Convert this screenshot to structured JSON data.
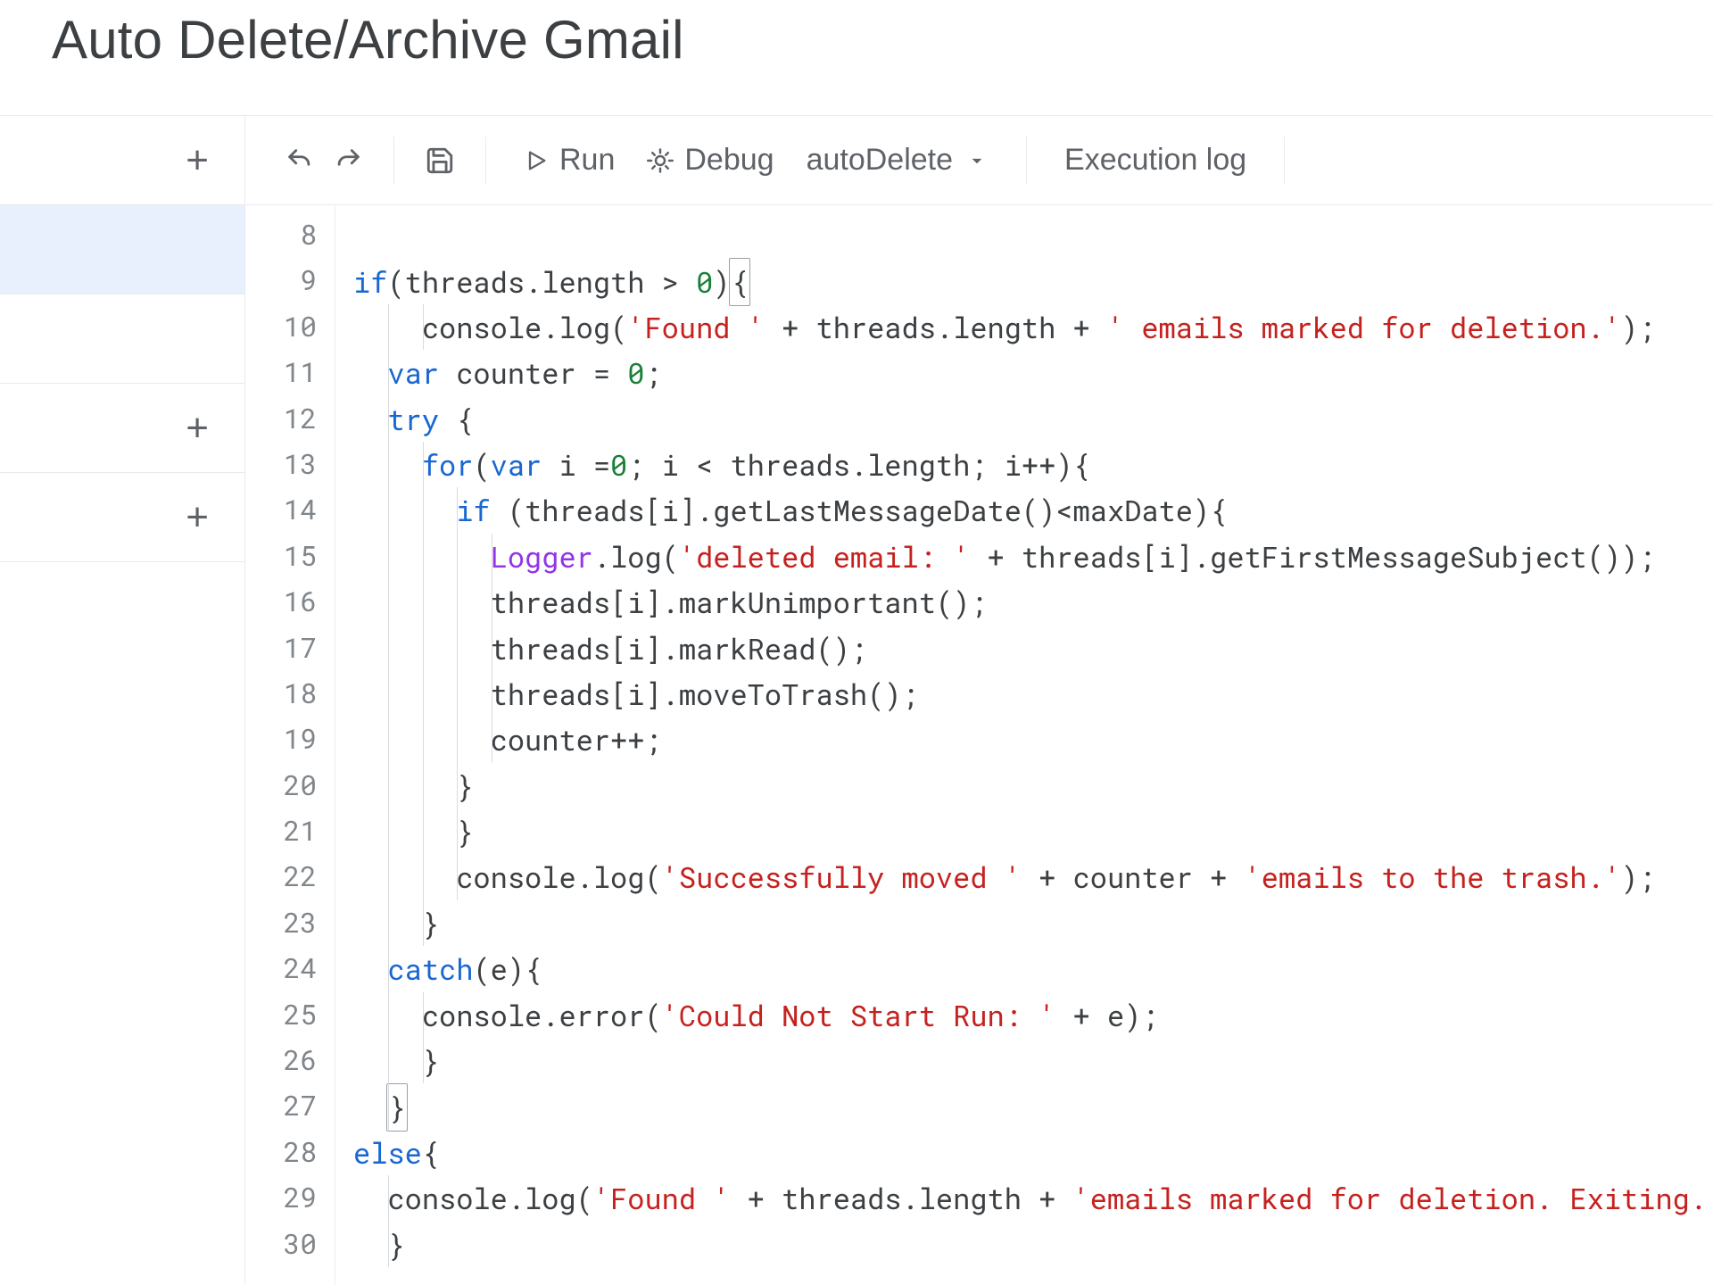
{
  "header": {
    "project_title": "Auto Delete/Archive Gmail"
  },
  "toolbar": {
    "run_label": "Run",
    "debug_label": "Debug",
    "function_selected": "autoDelete",
    "execution_log_label": "Execution log"
  },
  "sidebar": {
    "items": [
      {
        "icon": "plus",
        "selected": false
      },
      {
        "icon": "",
        "selected": true
      },
      {
        "icon": "",
        "selected": false
      },
      {
        "icon": "plus",
        "selected": false
      },
      {
        "icon": "plus",
        "selected": false
      }
    ]
  },
  "editor": {
    "first_line_number": 8,
    "highlighted_line_number": 11,
    "lines": [
      "",
      "if(threads.length > 0){",
      "    console.log('Found ' + threads.length + ' emails marked for deletion.');",
      "  var counter = 0;",
      "  try {",
      "    for(var i =0; i < threads.length; i++){",
      "      if (threads[i].getLastMessageDate()<maxDate){",
      "        Logger.log('deleted email: ' + threads[i].getFirstMessageSubject());",
      "        threads[i].markUnimportant();",
      "        threads[i].markRead();",
      "        threads[i].moveToTrash();",
      "        counter++;",
      "      }",
      "      }",
      "      console.log('Successfully moved ' + counter + 'emails to the trash.');",
      "    }",
      "  catch(e){",
      "    console.error('Could Not Start Run: ' + e);",
      "    }",
      "  }",
      "else{",
      "  console.log('Found ' + threads.length + 'emails marked for deletion. Exiting.');",
      "  }"
    ],
    "tokens": [
      [],
      [
        [
          "kw",
          "if"
        ],
        [
          "punc",
          "(threads.length > "
        ],
        [
          "num",
          "0"
        ],
        [
          "punc",
          ")"
        ],
        [
          "brace-open",
          "{"
        ]
      ],
      [
        [
          "punc",
          "    console.log("
        ],
        [
          "str",
          "'Found '"
        ],
        [
          "punc",
          " + threads.length + "
        ],
        [
          "str",
          "' emails marked for deletion.'"
        ],
        [
          "punc",
          ");"
        ]
      ],
      [
        [
          "punc",
          "  "
        ],
        [
          "kw",
          "var"
        ],
        [
          "punc",
          " counter = "
        ],
        [
          "num",
          "0"
        ],
        [
          "punc",
          ";"
        ]
      ],
      [
        [
          "punc",
          "  "
        ],
        [
          "kw",
          "try"
        ],
        [
          "punc",
          " {"
        ]
      ],
      [
        [
          "punc",
          "    "
        ],
        [
          "kw",
          "for"
        ],
        [
          "punc",
          "("
        ],
        [
          "kw",
          "var"
        ],
        [
          "punc",
          " i ="
        ],
        [
          "num",
          "0"
        ],
        [
          "punc",
          "; i < threads.length; i++){"
        ]
      ],
      [
        [
          "punc",
          "      "
        ],
        [
          "kw",
          "if"
        ],
        [
          "punc",
          " (threads[i].getLastMessageDate()<maxDate){"
        ]
      ],
      [
        [
          "punc",
          "        "
        ],
        [
          "cls",
          "Logger"
        ],
        [
          "punc",
          ".log("
        ],
        [
          "str",
          "'deleted email: '"
        ],
        [
          "punc",
          " + threads[i].getFirstMessageSubject());"
        ]
      ],
      [
        [
          "punc",
          "        threads[i].markUnimportant();"
        ]
      ],
      [
        [
          "punc",
          "        threads[i].markRead();"
        ]
      ],
      [
        [
          "punc",
          "        threads[i].moveToTrash();"
        ]
      ],
      [
        [
          "punc",
          "        counter++;"
        ]
      ],
      [
        [
          "punc",
          "      }"
        ]
      ],
      [
        [
          "punc",
          "      }"
        ]
      ],
      [
        [
          "punc",
          "      console.log("
        ],
        [
          "str",
          "'Successfully moved '"
        ],
        [
          "punc",
          " + counter + "
        ],
        [
          "str",
          "'emails to the trash.'"
        ],
        [
          "punc",
          ");"
        ]
      ],
      [
        [
          "punc",
          "    }"
        ]
      ],
      [
        [
          "punc",
          "  "
        ],
        [
          "kw",
          "catch"
        ],
        [
          "punc",
          "(e){"
        ]
      ],
      [
        [
          "punc",
          "    console.error("
        ],
        [
          "str",
          "'Could Not Start Run: '"
        ],
        [
          "punc",
          " + e);"
        ]
      ],
      [
        [
          "punc",
          "    }"
        ]
      ],
      [
        [
          "punc",
          "  "
        ],
        [
          "brace-close",
          "}"
        ]
      ],
      [
        [
          "kw",
          "else"
        ],
        [
          "punc",
          "{"
        ]
      ],
      [
        [
          "punc",
          "  console.log("
        ],
        [
          "str",
          "'Found '"
        ],
        [
          "punc",
          " + threads.length + "
        ],
        [
          "str",
          "'emails marked for deletion. Exiting.'"
        ],
        [
          "punc",
          ");"
        ]
      ],
      [
        [
          "punc",
          "  }"
        ]
      ]
    ]
  }
}
